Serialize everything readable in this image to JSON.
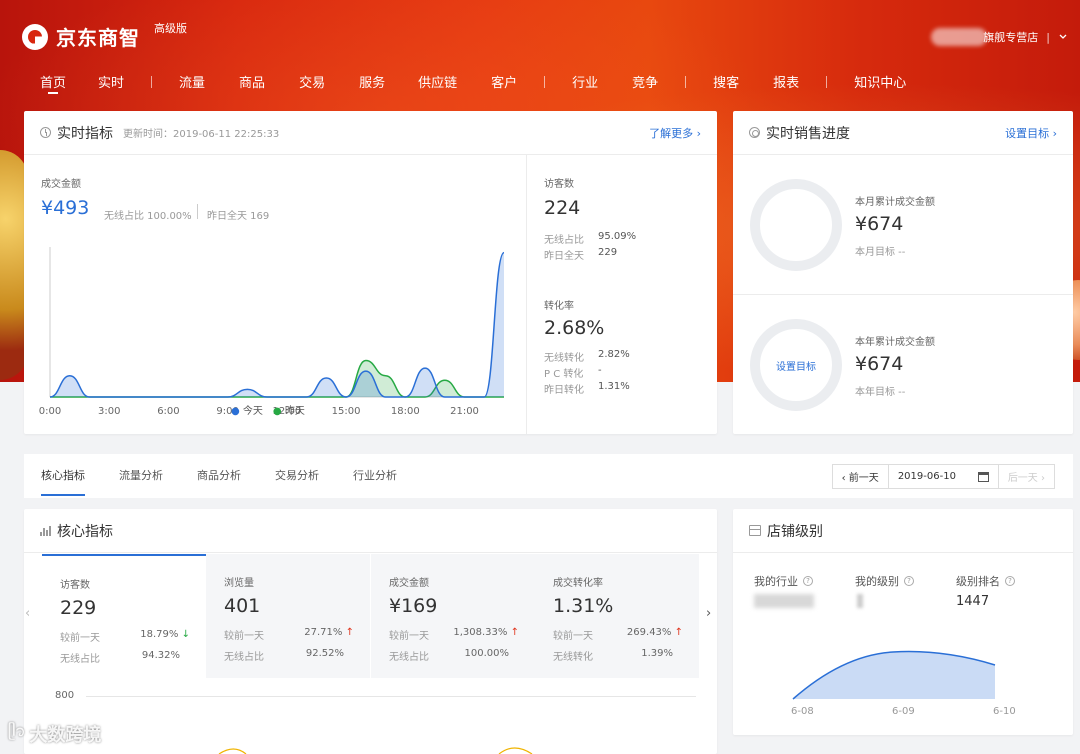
{
  "brand": {
    "name": "京东商智",
    "badge": "高级版"
  },
  "shop": {
    "name": "旗舰专营店",
    "separator": "|",
    "chevron": "chevron-down-icon"
  },
  "nav": {
    "items": [
      {
        "label": "首页",
        "active": true
      },
      {
        "label": "实时"
      },
      {
        "label": "流量"
      },
      {
        "label": "商品"
      },
      {
        "label": "交易"
      },
      {
        "label": "服务"
      },
      {
        "label": "供应链"
      },
      {
        "label": "客户"
      },
      {
        "label": "行业"
      },
      {
        "label": "竞争"
      },
      {
        "label": "搜客"
      },
      {
        "label": "报表"
      },
      {
        "label": "知识中心"
      }
    ]
  },
  "realtime": {
    "title": "实时指标",
    "update_time": "更新时间：2019-06-11 22:25:33",
    "more": "了解更多 ›",
    "gmv_label": "成交金额",
    "gmv_value": "¥493",
    "wireless_share": "无线占比 100.00%",
    "yesterday_total": "昨日全天 169",
    "legend_today": "今天",
    "legend_yesterday": "昨天",
    "visitors": {
      "label": "访客数",
      "value": "224",
      "r1_k": "无线占比",
      "r1_v": "95.09%",
      "r2_k": "昨日全天",
      "r2_v": "229"
    },
    "conversion": {
      "label": "转化率",
      "value": "2.68%",
      "r1_k": "无线转化",
      "r1_v": "2.82%",
      "r2_k": "P C 转化",
      "r2_v": "-",
      "r3_k": "昨日转化",
      "r3_v": "1.31%"
    }
  },
  "chart_data": {
    "type": "area",
    "x": [
      "0:00",
      "1:00",
      "2:00",
      "3:00",
      "4:00",
      "5:00",
      "6:00",
      "7:00",
      "8:00",
      "9:00",
      "10:00",
      "11:00",
      "12:00",
      "13:00",
      "14:00",
      "15:00",
      "16:00",
      "17:00",
      "18:00",
      "19:00",
      "20:00",
      "21:00",
      "22:00",
      "23:00"
    ],
    "tick_labels": [
      "0:00",
      "3:00",
      "6:00",
      "9:00",
      "12:00",
      "15:00",
      "18:00",
      "21:00"
    ],
    "series": [
      {
        "name": "今天",
        "color": "#2a6fd6",
        "values": [
          0,
          28,
          0,
          0,
          0,
          0,
          0,
          0,
          0,
          0,
          10,
          0,
          0,
          0,
          25,
          0,
          34,
          0,
          0,
          38,
          0,
          0,
          0,
          190
        ]
      },
      {
        "name": "昨天",
        "color": "#27a944",
        "values": [
          0,
          0,
          0,
          0,
          0,
          0,
          0,
          0,
          0,
          0,
          0,
          0,
          0,
          0,
          0,
          0,
          48,
          28,
          0,
          0,
          22,
          0,
          0,
          0
        ]
      }
    ],
    "legend": "bottom",
    "grid": false
  },
  "sales_progress": {
    "title": "实时销售进度",
    "set_target": "设置目标 ›",
    "month_label": "本月累计成交金额",
    "month_value": "¥674",
    "month_target": "本月目标 --",
    "year_label": "本年累计成交金额",
    "year_value": "¥674",
    "year_target": "本年目标 --",
    "ring_button": "设置目标"
  },
  "tabs": {
    "items": [
      {
        "label": "核心指标",
        "active": true
      },
      {
        "label": "流量分析"
      },
      {
        "label": "商品分析"
      },
      {
        "label": "交易分析"
      },
      {
        "label": "行业分析"
      }
    ],
    "prev_day": "‹ 前一天",
    "date": "2019-06-10",
    "next_day": "后一天 ›"
  },
  "core": {
    "title": "核心指标",
    "y_top": "800",
    "tiles": [
      {
        "label": "访客数",
        "value": "229",
        "r1_k": "较前一天",
        "r1_v": "18.79%",
        "r1_dir": "down",
        "r2_k": "无线占比",
        "r2_v": "94.32%"
      },
      {
        "label": "浏览量",
        "value": "401",
        "r1_k": "较前一天",
        "r1_v": "27.71%",
        "r1_dir": "up",
        "r2_k": "无线占比",
        "r2_v": "92.52%"
      },
      {
        "label": "成交金额",
        "value": "¥169",
        "r1_k": "较前一天",
        "r1_v": "1,308.33%",
        "r1_dir": "up",
        "r2_k": "无线占比",
        "r2_v": "100.00%"
      },
      {
        "label": "成交转化率",
        "value": "1.31%",
        "r1_k": "较前一天",
        "r1_v": "269.43%",
        "r1_dir": "up",
        "r2_k": "无线转化",
        "r2_v": "1.39%"
      }
    ]
  },
  "store_level": {
    "title": "店铺级别",
    "industry_label": "我的行业",
    "level_label": "我的级别",
    "rank_label": "级别排名",
    "rank_value": "1447",
    "dates": [
      "6-08",
      "6-09",
      "6-10"
    ]
  },
  "watermark": "大数跨境"
}
